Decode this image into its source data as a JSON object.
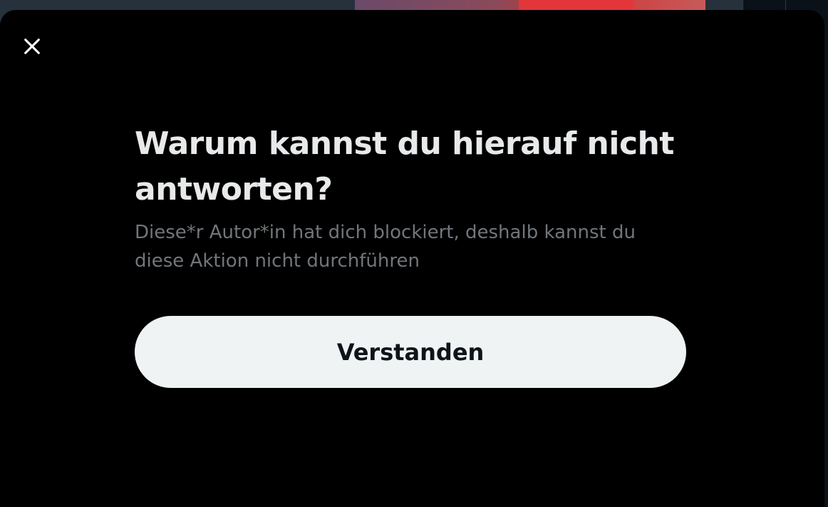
{
  "dialog": {
    "title": "Warum kannst du hierauf nicht antworten?",
    "message": "Diese*r Autor*in hat dich blockiert, deshalb kannst du diese Aktion nicht durchführen",
    "confirm_label": "Verstanden",
    "close_icon": "close-icon"
  },
  "colors": {
    "modal_bg": "#000000",
    "title": "#e7e9ea",
    "message": "#71767b",
    "button_bg": "#eff3f4",
    "button_text": "#0f1419"
  }
}
